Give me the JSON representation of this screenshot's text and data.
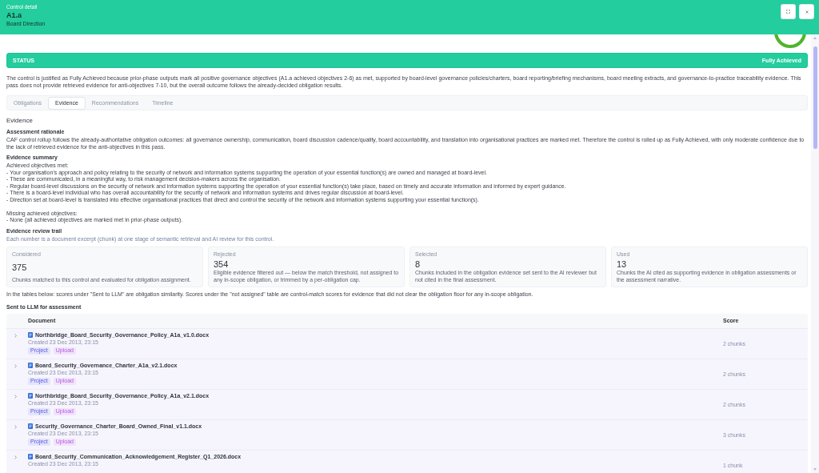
{
  "header": {
    "eyebrow": "Control detail",
    "title": "A1.a",
    "subtitle": "Board Direction",
    "buttons": [
      {
        "kind": "expand"
      },
      {
        "kind": "close"
      }
    ]
  },
  "status": {
    "label": "STATUS",
    "value": "Fully Achieved"
  },
  "justification": "The control is justified as Fully Achieved because prior-phase outputs mark all positive governance objectives (A1.a achieved objectives 2-6) as met, supported by board-level governance policies/charters, board reporting/briefing mechanisms, board meeting extracts, and governance-to-practice traceability evidence. This pass does not provide retrieved evidence for anti-objectives 7-10, but the overall outcome follows the already-decided obligation results.",
  "tabs": [
    {
      "label": "Obligations",
      "selected": false
    },
    {
      "label": "Evidence",
      "selected": true
    },
    {
      "label": "Recommendations",
      "selected": false
    },
    {
      "label": "Timeline",
      "selected": false
    }
  ],
  "evidence": {
    "heading": "Evidence",
    "rationale": {
      "title": "Assessment rationale",
      "text": "CAF control rollup follows the already-authoritative obligation outcomes: all governance ownership, communication, board discussion cadence/quality, board accountability, and translation into organisational practices are marked met. Therefore the control is rolled up as Fully Achieved, with only moderate confidence due to the lack of retrieved evidence for the anti-objectives in this pass."
    },
    "summary": {
      "title": "Evidence summary",
      "groups": [
        {
          "label": "Achieved objectives met:",
          "items": [
            "- Your organisation's approach and policy relating to the security of network and information systems supporting the operation of your essential function(s) are owned and managed at board-level.",
            "- These are communicated, in a meaningful way, to risk management decision-makers across the organisation.",
            "- Regular board-level discussions on the security of network and information systems supporting the operation of your essential function(s) take place, based on timely and accurate information and informed by expert guidance.",
            "- There is a board-level individual who has overall accountability for the security of network and information systems and drives regular discussion at board-level.",
            "- Direction set at board-level is translated into effective organisational practices that direct and control the security of the network and information systems supporting your essential function(s)."
          ]
        },
        {
          "label": "Missing achieved objectives:",
          "items": [
            "- None (all achieved objectives are marked met in prior-phase outputs)."
          ]
        }
      ]
    },
    "review_trail": {
      "title": "Evidence review trail",
      "note": "Each number is a document excerpt (chunk) at one stage of semantic retrieval and AI review for this control.",
      "stats": [
        {
          "label": "Considered",
          "value": "375",
          "description": "Chunks matched to this control and evaluated for obligation assignment."
        },
        {
          "label": "Rejected",
          "value": "354",
          "description": "Eligible evidence filtered out — below the match threshold, not assigned to any in-scope obligation, or trimmed by a per-obligation cap."
        },
        {
          "label": "Selected",
          "value": "8",
          "description": "Chunks included in the obligation evidence set sent to the AI reviewer but not cited in the final assessment."
        },
        {
          "label": "Used",
          "value": "13",
          "description": "Chunks the AI cited as supporting evidence in obligation assessments or the assessment narrative."
        }
      ]
    },
    "tables_note": "In the tables below: scores under \"Sent to LLM\" are obligation similarity. Scores under the \"not assigned\" table are control-match scores for evidence that did not clear the obligation floor for any in-scope obligation.",
    "sent_table": {
      "title": "Sent to LLM for assessment",
      "columns": [
        "Document",
        "Score"
      ],
      "rows": [
        {
          "expanded": false,
          "file": "Northbridge_Board_Security_Governance_Policy_A1a_v1.0.docx",
          "created": "Created 23 Dec 2013, 23:15",
          "tags": [
            {
              "label": "Project",
              "color": "#e4e4fb"
            },
            {
              "label": "Upload",
              "color": "#f2e2fb"
            }
          ],
          "score": "2 chunks"
        },
        {
          "expanded": false,
          "file": "Board_Security_Governance_Charter_A1a_v2.1.docx",
          "created": "Created 23 Dec 2013, 23:15",
          "tags": [
            {
              "label": "Project",
              "color": "#e4e4fb"
            },
            {
              "label": "Upload",
              "color": "#f2e2fb"
            }
          ],
          "score": "2 chunks"
        },
        {
          "expanded": false,
          "file": "Northbridge_Board_Security_Governance_Policy_A1a_v2.1.docx",
          "created": "Created 23 Dec 2013, 23:15",
          "tags": [
            {
              "label": "Project",
              "color": "#e4e4fb"
            },
            {
              "label": "Upload",
              "color": "#f2e2fb"
            }
          ],
          "score": "2 chunks"
        },
        {
          "expanded": false,
          "file": "Security_Governance_Charter_Board_Owned_Final_v1.1.docx",
          "created": "Created 23 Dec 2013, 23:15",
          "tags": [
            {
              "label": "Project",
              "color": "#e4e4fb"
            },
            {
              "label": "Upload",
              "color": "#f2e2fb"
            }
          ],
          "score": "3 chunks"
        },
        {
          "expanded": false,
          "file": "Board_Security_Communication_Acknowledgement_Register_Q1_2026.docx",
          "created": "Created 23 Dec 2013, 23:15",
          "score": "1 chunk"
        }
      ]
    }
  }
}
